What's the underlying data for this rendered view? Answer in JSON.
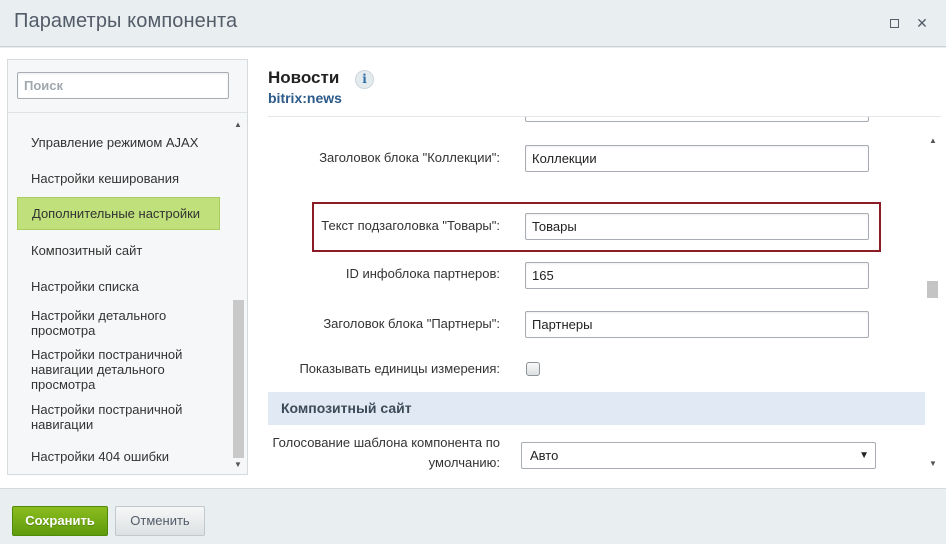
{
  "window": {
    "title": "Параметры компонента",
    "maximize_icon": "maximize-icon",
    "close_label": "✕"
  },
  "sidebar": {
    "search_placeholder": "Поиск",
    "items": [
      {
        "label": "Управление режимом AJAX",
        "active": false
      },
      {
        "label": "Настройки кеширования",
        "active": false
      },
      {
        "label": "Дополнительные настройки",
        "active": true
      },
      {
        "label": "Композитный сайт",
        "active": false
      },
      {
        "label": "Настройки списка",
        "active": false
      },
      {
        "label": "Настройки детального просмотра",
        "active": false
      },
      {
        "label": "Настройки постраничной навигации детального просмотра",
        "active": false
      },
      {
        "label": "Настройки постраничной навигации",
        "active": false
      },
      {
        "label": "Настройки 404 ошибки",
        "active": false
      }
    ]
  },
  "header": {
    "title": "Новости",
    "subtitle": "bitrix:news",
    "info_icon": "i"
  },
  "form": {
    "rows": [
      {
        "label": "Заголовок блока \"Коллекции\":",
        "value": "Коллекции"
      },
      {
        "label": "Текст подзаголовка \"Товары\":",
        "value": "Товары",
        "highlighted": true
      },
      {
        "label": "ID инфоблока партнеров:",
        "value": "165"
      },
      {
        "label": "Заголовок блока \"Партнеры\":",
        "value": "Партнеры"
      }
    ],
    "checkbox_row": {
      "label": "Показывать единицы измерения:",
      "checked": false
    },
    "section": {
      "title": "Композитный сайт"
    },
    "select_row": {
      "label_line1": "Голосование шаблона компонента по",
      "label_line2": "умолчанию:",
      "value": "Авто"
    }
  },
  "footer": {
    "save_label": "Сохранить",
    "cancel_label": "Отменить"
  },
  "colors": {
    "accent_green": "#8bbc1f",
    "active_item": "#bfe07b",
    "highlight_border": "#8b1c25",
    "section_band": "#e0e9f4",
    "link_blue": "#2c5a8a"
  }
}
